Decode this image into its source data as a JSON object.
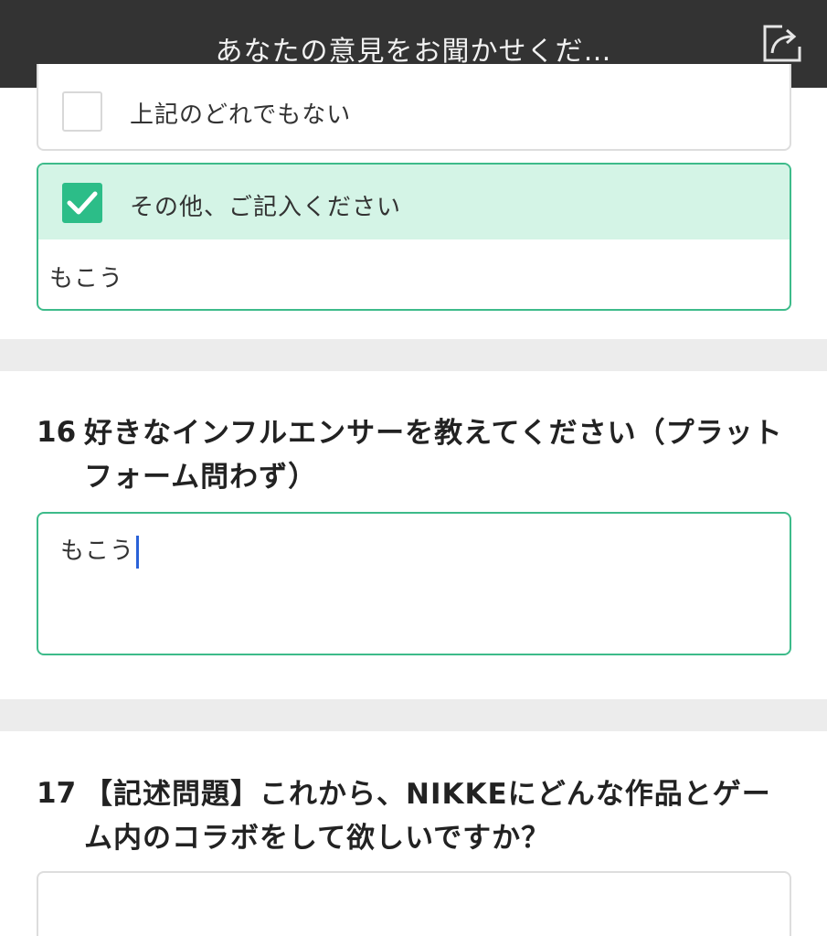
{
  "header": {
    "title": "あなたの意見をお聞かせくだ…",
    "share_icon": "share-icon"
  },
  "q15": {
    "option_none": {
      "label": "上記のどれでもない",
      "checked": false
    },
    "option_other": {
      "label": "その他、ご記入ください",
      "checked": true,
      "value": "もこう"
    }
  },
  "q16": {
    "number": "16",
    "text": "好きなインフルエンサーを教えてください（プラットフォーム問わず）",
    "answer": "もこう"
  },
  "q17": {
    "number": "17",
    "text": "【記述問題】これから、NIKKEにどんな作品とゲーム内のコラボをして欲しいですか？",
    "answer": ""
  },
  "colors": {
    "accent_green": "#2cbd88",
    "selected_bg": "#d4f4e6",
    "topbar_bg": "#333333",
    "caret": "#2a62d8"
  }
}
